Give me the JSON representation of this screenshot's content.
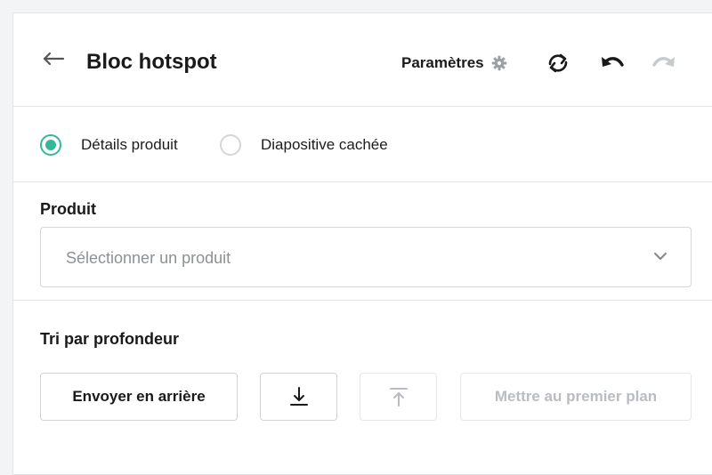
{
  "header": {
    "title": "Bloc hotspot",
    "settings_label": "Paramètres",
    "icons": {
      "back": "arrow-left-icon",
      "settings": "gear-icon",
      "sync": "sync-icon",
      "undo": "undo-icon",
      "redo": "redo-icon"
    }
  },
  "radios": {
    "options": [
      {
        "label": "Détails produit",
        "checked": true
      },
      {
        "label": "Diapositive cachée",
        "checked": false
      }
    ]
  },
  "product": {
    "label": "Produit",
    "select_placeholder": "Sélectionner un produit"
  },
  "depth": {
    "label": "Tri par profondeur",
    "send_back_label": "Envoyer en arrière",
    "bring_front_label": "Mettre au premier plan"
  },
  "colors": {
    "accent": "#35b89a",
    "border": "#e3e4e6",
    "disabled_text": "#b9bcc0"
  }
}
